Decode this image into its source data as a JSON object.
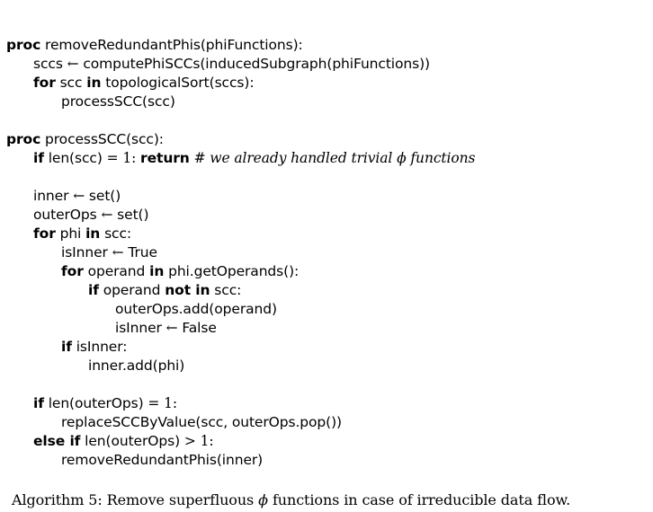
{
  "algorithm": {
    "lines": [
      {
        "kw": "proc",
        "text": "removeRedundantPhis(phiFunctions):"
      },
      {
        "lhs": "sccs",
        "arrow": "←",
        "rhs": "computePhiSCCs(inducedSubgraph(phiFunctions))"
      },
      {
        "kw": "for",
        "var": "scc",
        "kw2": "in",
        "rest": "topologicalSort(sccs):"
      },
      {
        "text": "processSCC(scc)"
      },
      {
        "kw": "proc",
        "text": "processSCC(scc):"
      },
      {
        "kw": "if",
        "cond": "len(scc)",
        "op": "=",
        "num": "1",
        "sep": ":",
        "kw2": "return",
        "hash": "#",
        "comment": "we already handled trivial",
        "phi": "ϕ",
        "comment2": "functions"
      },
      {
        "lhs": "inner",
        "arrow": "←",
        "rhs": "set()"
      },
      {
        "lhs": "outerOps",
        "arrow": "←",
        "rhs": "set()"
      },
      {
        "kw": "for",
        "var": "phi",
        "kw2": "in",
        "rest": "scc:"
      },
      {
        "lhs": "isInner",
        "arrow": "←",
        "rhs": "True"
      },
      {
        "kw": "for",
        "var": "operand",
        "kw2": "in",
        "rest": "phi.getOperands():"
      },
      {
        "kw": "if",
        "var": "operand",
        "kw2": "not in",
        "rest": "scc:"
      },
      {
        "text": "outerOps.add(operand)"
      },
      {
        "lhs": "isInner",
        "arrow": "←",
        "rhs": "False"
      },
      {
        "kw": "if",
        "text": "isInner:"
      },
      {
        "text": "inner.add(phi)"
      },
      {
        "kw": "if",
        "cond": "len(outerOps)",
        "op": "=",
        "num": "1",
        "sep": ":"
      },
      {
        "text": "replaceSCCByValue(scc, outerOps.pop())"
      },
      {
        "kw": "else if",
        "cond": "len(outerOps)",
        "op": ">",
        "num": "1",
        "sep": ":"
      },
      {
        "text": "removeRedundantPhis(inner)"
      }
    ]
  },
  "caption": {
    "prefix": "Algorithm 5: Remove superfluous",
    "phi": "ϕ",
    "suffix": "functions in case of irreducible data flow."
  }
}
